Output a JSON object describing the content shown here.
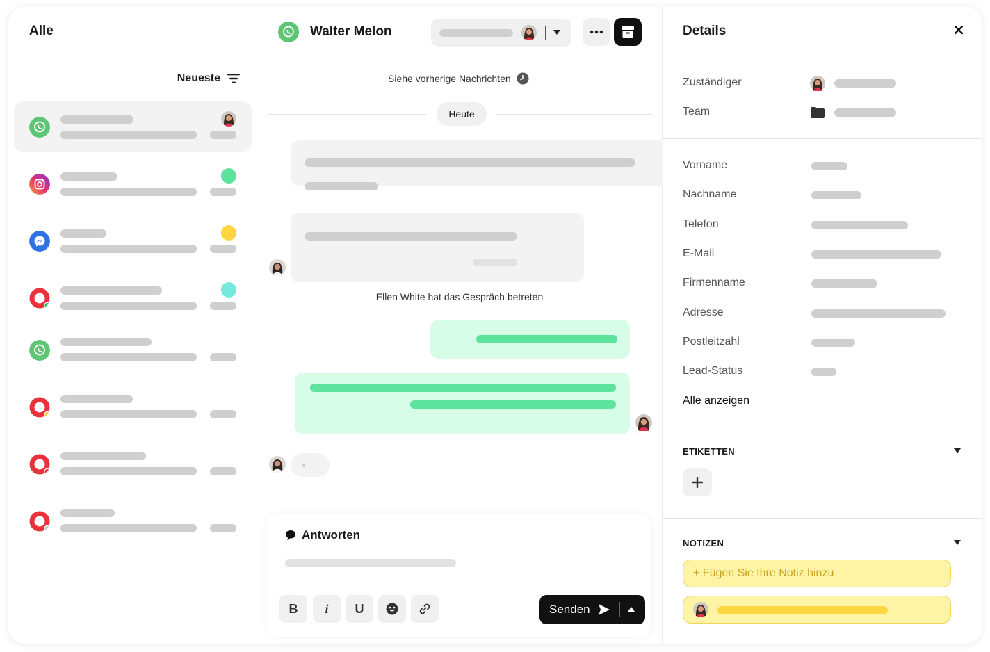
{
  "list": {
    "title": "Alle",
    "sort_label": "Neueste"
  },
  "chat": {
    "contact_name": "Walter Melon",
    "previous_messages": "Siehe vorherige Nachrichten",
    "day_label": "Heute",
    "system_message": "Ellen White hat das Gespräch betreten",
    "reply_label": "Antworten",
    "send_label": "Senden",
    "format_buttons": [
      "B",
      "i",
      "U"
    ]
  },
  "details": {
    "title": "Details",
    "fields_top": [
      "Zuständiger",
      "Team"
    ],
    "fields": [
      "Vorname",
      "Nachname",
      "Telefon",
      "E-Mail",
      "Firmenname",
      "Adresse",
      "Postleitzahl",
      "Lead-Status"
    ],
    "show_all": "Alle anzeigen",
    "tags_title": "ETIKETTEN",
    "notes_title": "NOTIZEN",
    "note_placeholder": "+ Fügen Sie Ihre Notiz hinzu"
  },
  "colors": {
    "whatsapp": "#5ec575",
    "messenger": "#2f72e6",
    "brand_red": "#e8323c",
    "green_status": "#5ee39e",
    "yellow_status": "#ffd640",
    "teal_status": "#73eadd",
    "outgoing_bubble": "#d7fde9",
    "note_yellow": "#fff3a6"
  }
}
